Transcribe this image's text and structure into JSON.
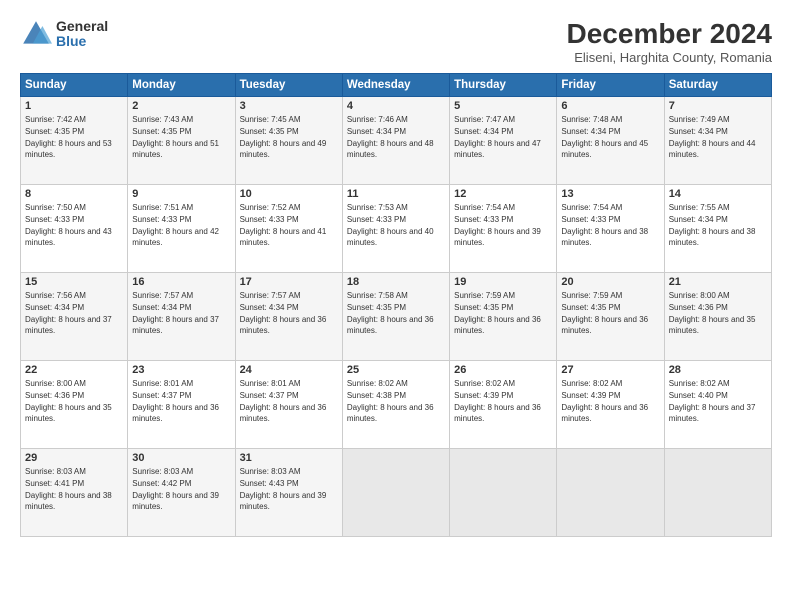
{
  "logo": {
    "general": "General",
    "blue": "Blue"
  },
  "title": "December 2024",
  "subtitle": "Eliseni, Harghita County, Romania",
  "days_of_week": [
    "Sunday",
    "Monday",
    "Tuesday",
    "Wednesday",
    "Thursday",
    "Friday",
    "Saturday"
  ],
  "weeks": [
    [
      {
        "day": "1",
        "sunrise": "7:42 AM",
        "sunset": "4:35 PM",
        "daylight": "8 hours and 53 minutes."
      },
      {
        "day": "2",
        "sunrise": "7:43 AM",
        "sunset": "4:35 PM",
        "daylight": "8 hours and 51 minutes."
      },
      {
        "day": "3",
        "sunrise": "7:45 AM",
        "sunset": "4:35 PM",
        "daylight": "8 hours and 49 minutes."
      },
      {
        "day": "4",
        "sunrise": "7:46 AM",
        "sunset": "4:34 PM",
        "daylight": "8 hours and 48 minutes."
      },
      {
        "day": "5",
        "sunrise": "7:47 AM",
        "sunset": "4:34 PM",
        "daylight": "8 hours and 47 minutes."
      },
      {
        "day": "6",
        "sunrise": "7:48 AM",
        "sunset": "4:34 PM",
        "daylight": "8 hours and 45 minutes."
      },
      {
        "day": "7",
        "sunrise": "7:49 AM",
        "sunset": "4:34 PM",
        "daylight": "8 hours and 44 minutes."
      }
    ],
    [
      {
        "day": "8",
        "sunrise": "7:50 AM",
        "sunset": "4:33 PM",
        "daylight": "8 hours and 43 minutes."
      },
      {
        "day": "9",
        "sunrise": "7:51 AM",
        "sunset": "4:33 PM",
        "daylight": "8 hours and 42 minutes."
      },
      {
        "day": "10",
        "sunrise": "7:52 AM",
        "sunset": "4:33 PM",
        "daylight": "8 hours and 41 minutes."
      },
      {
        "day": "11",
        "sunrise": "7:53 AM",
        "sunset": "4:33 PM",
        "daylight": "8 hours and 40 minutes."
      },
      {
        "day": "12",
        "sunrise": "7:54 AM",
        "sunset": "4:33 PM",
        "daylight": "8 hours and 39 minutes."
      },
      {
        "day": "13",
        "sunrise": "7:54 AM",
        "sunset": "4:33 PM",
        "daylight": "8 hours and 38 minutes."
      },
      {
        "day": "14",
        "sunrise": "7:55 AM",
        "sunset": "4:34 PM",
        "daylight": "8 hours and 38 minutes."
      }
    ],
    [
      {
        "day": "15",
        "sunrise": "7:56 AM",
        "sunset": "4:34 PM",
        "daylight": "8 hours and 37 minutes."
      },
      {
        "day": "16",
        "sunrise": "7:57 AM",
        "sunset": "4:34 PM",
        "daylight": "8 hours and 37 minutes."
      },
      {
        "day": "17",
        "sunrise": "7:57 AM",
        "sunset": "4:34 PM",
        "daylight": "8 hours and 36 minutes."
      },
      {
        "day": "18",
        "sunrise": "7:58 AM",
        "sunset": "4:35 PM",
        "daylight": "8 hours and 36 minutes."
      },
      {
        "day": "19",
        "sunrise": "7:59 AM",
        "sunset": "4:35 PM",
        "daylight": "8 hours and 36 minutes."
      },
      {
        "day": "20",
        "sunrise": "7:59 AM",
        "sunset": "4:35 PM",
        "daylight": "8 hours and 36 minutes."
      },
      {
        "day": "21",
        "sunrise": "8:00 AM",
        "sunset": "4:36 PM",
        "daylight": "8 hours and 35 minutes."
      }
    ],
    [
      {
        "day": "22",
        "sunrise": "8:00 AM",
        "sunset": "4:36 PM",
        "daylight": "8 hours and 35 minutes."
      },
      {
        "day": "23",
        "sunrise": "8:01 AM",
        "sunset": "4:37 PM",
        "daylight": "8 hours and 36 minutes."
      },
      {
        "day": "24",
        "sunrise": "8:01 AM",
        "sunset": "4:37 PM",
        "daylight": "8 hours and 36 minutes."
      },
      {
        "day": "25",
        "sunrise": "8:02 AM",
        "sunset": "4:38 PM",
        "daylight": "8 hours and 36 minutes."
      },
      {
        "day": "26",
        "sunrise": "8:02 AM",
        "sunset": "4:39 PM",
        "daylight": "8 hours and 36 minutes."
      },
      {
        "day": "27",
        "sunrise": "8:02 AM",
        "sunset": "4:39 PM",
        "daylight": "8 hours and 36 minutes."
      },
      {
        "day": "28",
        "sunrise": "8:02 AM",
        "sunset": "4:40 PM",
        "daylight": "8 hours and 37 minutes."
      }
    ],
    [
      {
        "day": "29",
        "sunrise": "8:03 AM",
        "sunset": "4:41 PM",
        "daylight": "8 hours and 38 minutes."
      },
      {
        "day": "30",
        "sunrise": "8:03 AM",
        "sunset": "4:42 PM",
        "daylight": "8 hours and 39 minutes."
      },
      {
        "day": "31",
        "sunrise": "8:03 AM",
        "sunset": "4:43 PM",
        "daylight": "8 hours and 39 minutes."
      },
      null,
      null,
      null,
      null
    ]
  ],
  "labels": {
    "sunrise": "Sunrise:",
    "sunset": "Sunset:",
    "daylight": "Daylight:"
  }
}
